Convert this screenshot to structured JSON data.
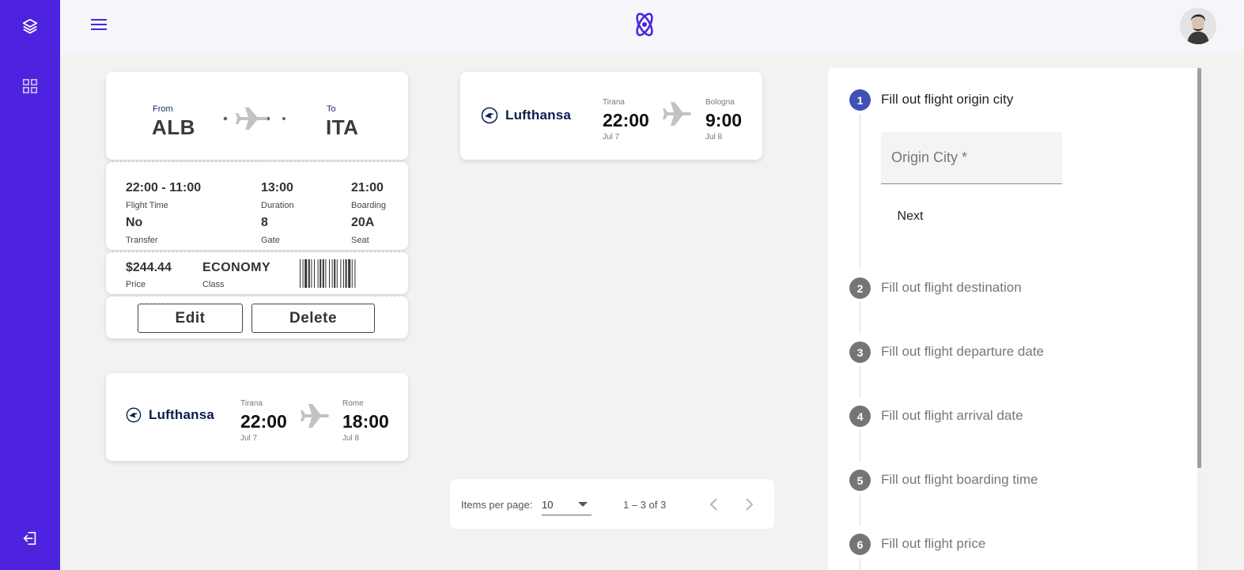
{
  "sidebar": {
    "top_icons": [
      "layers-icon",
      "grid-icon"
    ],
    "bottom_icon": "logout-icon",
    "color": "#4d23df"
  },
  "header": {
    "menu_icon": "hamburger-menu-icon",
    "logo_icon": "atom-logo-icon",
    "avatar_icon": "user-avatar"
  },
  "ticket": {
    "from_label": "From",
    "from_code": "ALB",
    "to_label": "To",
    "to_code": "ITA",
    "flight_time_value": "22:00 - 11:00",
    "flight_time_label": "Flight Time",
    "duration_value": "13:00",
    "duration_label": "Duration",
    "boarding_value": "21:00",
    "boarding_label": "Boarding",
    "transfer_value": "No",
    "transfer_label": "Transfer",
    "gate_value": "8",
    "gate_label": "Gate",
    "seat_value": "20A",
    "seat_label": "Seat",
    "price_value": "$244.44",
    "price_label": "Price",
    "class_value": "ECONOMY",
    "class_label": "Class",
    "edit_label": "Edit",
    "delete_label": "Delete"
  },
  "flights": [
    {
      "airline": "Lufthansa",
      "origin_city": "Tirana",
      "departure_time": "22:00",
      "departure_date": "Jul 7",
      "destination_city": "Bologna",
      "arrival_time": "9:00",
      "arrival_date": "Jul 8"
    },
    {
      "airline": "Lufthansa",
      "origin_city": "Tirana",
      "departure_time": "22:00",
      "departure_date": "Jul 7",
      "destination_city": "Rome",
      "arrival_time": "18:00",
      "arrival_date": "Jul 8"
    }
  ],
  "paginator": {
    "items_per_page_label": "Items per page:",
    "items_per_page_value": "10",
    "range_label": "1 – 3 of 3"
  },
  "stepper": {
    "steps": [
      {
        "number": "1",
        "title": "Fill out flight origin city",
        "active": true
      },
      {
        "number": "2",
        "title": "Fill out flight destination",
        "active": false
      },
      {
        "number": "3",
        "title": "Fill out flight departure date",
        "active": false
      },
      {
        "number": "4",
        "title": "Fill out flight arrival date",
        "active": false
      },
      {
        "number": "5",
        "title": "Fill out flight boarding time",
        "active": false
      },
      {
        "number": "6",
        "title": "Fill out flight price",
        "active": false
      }
    ],
    "origin_placeholder": "Origin City *",
    "origin_value": "",
    "next_label": "Next",
    "active_color": "#3f51b5",
    "inactive_color": "#757575"
  }
}
